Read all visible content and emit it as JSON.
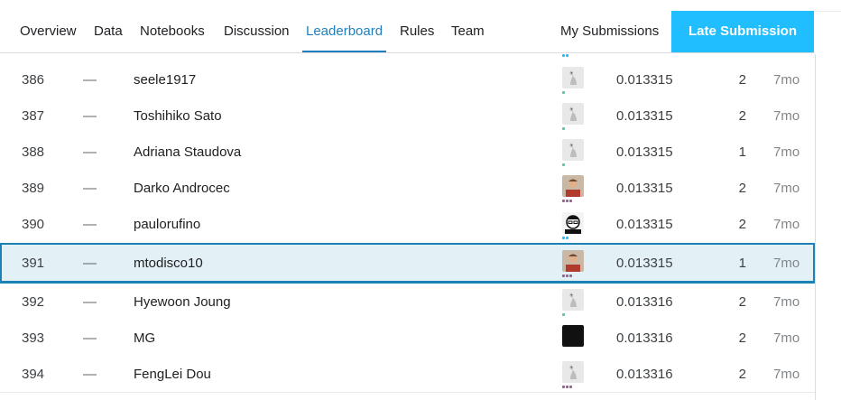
{
  "nav": {
    "tabs": [
      "Overview",
      "Data",
      "Notebooks",
      "Discussion",
      "Leaderboard",
      "Rules",
      "Team"
    ],
    "active_tab": "Leaderboard",
    "my_submissions": "My Submissions",
    "late_submission": "Late Submission"
  },
  "colors": {
    "accent": "#20beff",
    "active_tab": "#1f7fbf",
    "highlight_bg": "#e3f1f7",
    "highlight_border": "#1b82b3",
    "tier_novice": "#5ac995",
    "tier_contributor": "#20beff",
    "tier_expert": "#95628f"
  },
  "leaderboard": {
    "rows": [
      {
        "rank": "386",
        "delta": "—",
        "team": "seele1917",
        "score": "0.013315",
        "entries": "2",
        "last": "7mo",
        "avatar": "goose-avatar-icon",
        "tier": "novice"
      },
      {
        "rank": "387",
        "delta": "—",
        "team": "Toshihiko Sato",
        "score": "0.013315",
        "entries": "2",
        "last": "7mo",
        "avatar": "goose-avatar-icon",
        "tier": "novice"
      },
      {
        "rank": "388",
        "delta": "—",
        "team": "Adriana Staudova",
        "score": "0.013315",
        "entries": "1",
        "last": "7mo",
        "avatar": "goose-avatar-icon",
        "tier": "novice"
      },
      {
        "rank": "389",
        "delta": "—",
        "team": "Darko Androcec",
        "score": "0.013315",
        "entries": "2",
        "last": "7mo",
        "avatar": "photo-avatar-icon",
        "tier": "expert"
      },
      {
        "rank": "390",
        "delta": "—",
        "team": "paulorufino",
        "score": "0.013315",
        "entries": "2",
        "last": "7mo",
        "avatar": "cartoon-avatar-icon",
        "tier": "contributor"
      },
      {
        "rank": "391",
        "delta": "—",
        "team": "mtodisco10",
        "score": "0.013315",
        "entries": "1",
        "last": "7mo",
        "avatar": "photo-avatar-icon",
        "tier": "expert",
        "highlighted": true
      },
      {
        "rank": "392",
        "delta": "—",
        "team": "Hyewoon Joung",
        "score": "0.013316",
        "entries": "2",
        "last": "7mo",
        "avatar": "goose-avatar-icon",
        "tier": "novice"
      },
      {
        "rank": "393",
        "delta": "—",
        "team": "MG",
        "score": "0.013316",
        "entries": "2",
        "last": "7mo",
        "avatar": "dark-avatar-icon",
        "tier": "none"
      },
      {
        "rank": "394",
        "delta": "—",
        "team": "FengLei Dou",
        "score": "0.013316",
        "entries": "2",
        "last": "7mo",
        "avatar": "goose-avatar-icon",
        "tier": "expert"
      }
    ]
  }
}
